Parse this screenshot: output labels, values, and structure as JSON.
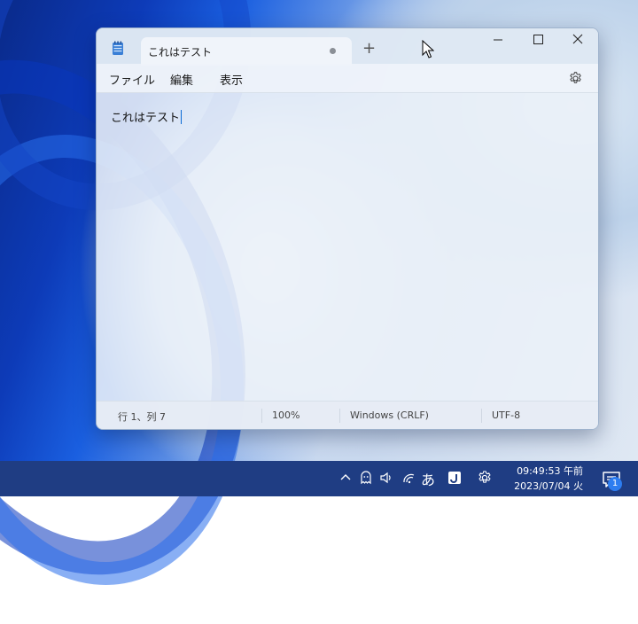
{
  "window": {
    "tab_title": "これはテスト",
    "new_tab_symbol": "+"
  },
  "menubar": {
    "items": [
      "ファイル",
      "編集",
      "表示"
    ]
  },
  "editor": {
    "content": "これはテスト"
  },
  "statusbar": {
    "position": "行 1、列 7",
    "zoom": "100%",
    "line_ending": "Windows (CRLF)",
    "encoding": "UTF-8"
  },
  "taskbar": {
    "ime_mode": "あ",
    "time": "09:49:53 午前",
    "date": "2023/07/04 火",
    "notification_count": "1"
  },
  "icons": [
    "notepad-icon",
    "minimize-icon",
    "maximize-icon",
    "close-icon",
    "gear-icon",
    "mouse-pointer-icon",
    "chevron-up-icon",
    "ghost-icon",
    "speaker-icon",
    "wifi-icon",
    "app-j-icon",
    "settings-icon",
    "notification-icon"
  ]
}
